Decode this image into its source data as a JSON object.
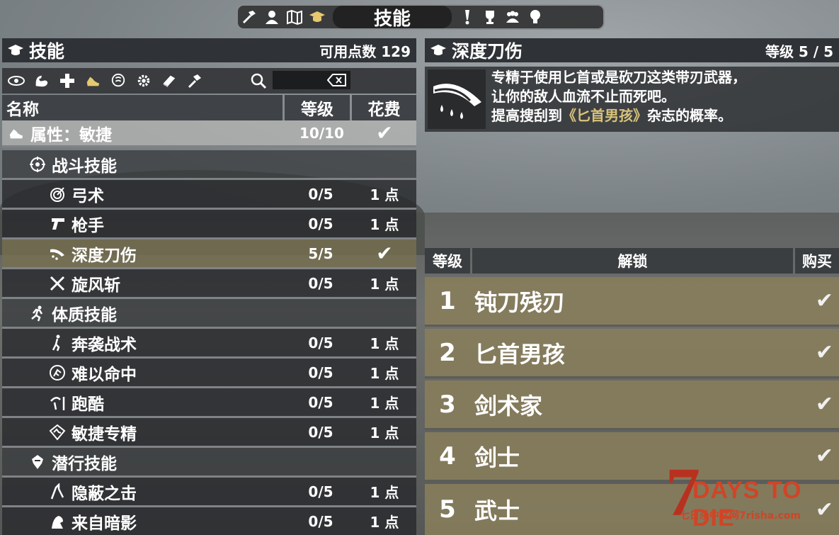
{
  "topbar": {
    "title": "技能",
    "icons": [
      "crafting-hammer-icon",
      "character-icon",
      "map-icon",
      "skills-cap-icon",
      "quests-exclamation-icon",
      "trophy-icon",
      "players-icon",
      "lightbulb-icon"
    ]
  },
  "left_panel": {
    "title": "技能",
    "points_label": "可用点数 129",
    "columns": {
      "name": "名称",
      "level": "等级",
      "cost": "花费"
    },
    "rows": [
      {
        "name": "属性：敏捷",
        "level": "10/10",
        "cost": "✔",
        "type": "attr"
      },
      {
        "name": "战斗技能",
        "level": "",
        "cost": "",
        "type": "cat"
      },
      {
        "name": "弓术",
        "level": "0/5",
        "cost": "1 点",
        "type": "skill"
      },
      {
        "name": "枪手",
        "level": "0/5",
        "cost": "1 点",
        "type": "skill"
      },
      {
        "name": "深度刀伤",
        "level": "5/5",
        "cost": "✔",
        "type": "sel"
      },
      {
        "name": "旋风斩",
        "level": "0/5",
        "cost": "1 点",
        "type": "skill"
      },
      {
        "name": "体质技能",
        "level": "",
        "cost": "",
        "type": "cat"
      },
      {
        "name": "奔袭战术",
        "level": "0/5",
        "cost": "1 点",
        "type": "skill"
      },
      {
        "name": "难以命中",
        "level": "0/5",
        "cost": "1 点",
        "type": "skill"
      },
      {
        "name": "跑酷",
        "level": "0/5",
        "cost": "1 点",
        "type": "skill"
      },
      {
        "name": "敏捷专精",
        "level": "0/5",
        "cost": "1 点",
        "type": "skill"
      },
      {
        "name": "潜行技能",
        "level": "",
        "cost": "",
        "type": "cat"
      },
      {
        "name": "隐蔽之击",
        "level": "0/5",
        "cost": "1 点",
        "type": "skill"
      },
      {
        "name": "来自暗影",
        "level": "0/5",
        "cost": "1 点",
        "type": "skill"
      }
    ]
  },
  "right_panel": {
    "title": "深度刀伤",
    "level_label": "等级 5 / 5",
    "desc_line1": "专精于使用匕首或是砍刀这类带刃武器，",
    "desc_line2": "让你的敌人血流不止而死吧。",
    "desc_line3_pre": "提高搜刮到",
    "desc_line3_highlight": "《匕首男孩》",
    "desc_line3_post": "杂志的概率。",
    "columns": {
      "level": "等级",
      "unlock": "解锁",
      "buy": "购买"
    },
    "unlocks": [
      {
        "num": "1",
        "name": "钝刀残刃",
        "check": "✔"
      },
      {
        "num": "2",
        "name": "匕首男孩",
        "check": "✔"
      },
      {
        "num": "3",
        "name": "剑术家",
        "check": "✔"
      },
      {
        "num": "4",
        "name": "剑士",
        "check": "✔"
      },
      {
        "num": "5",
        "name": "武士",
        "check": "✔"
      }
    ]
  },
  "logo": {
    "seven": "7",
    "days": "DAYS TO DIE",
    "sub": "七日杀中文网7risha.com"
  }
}
